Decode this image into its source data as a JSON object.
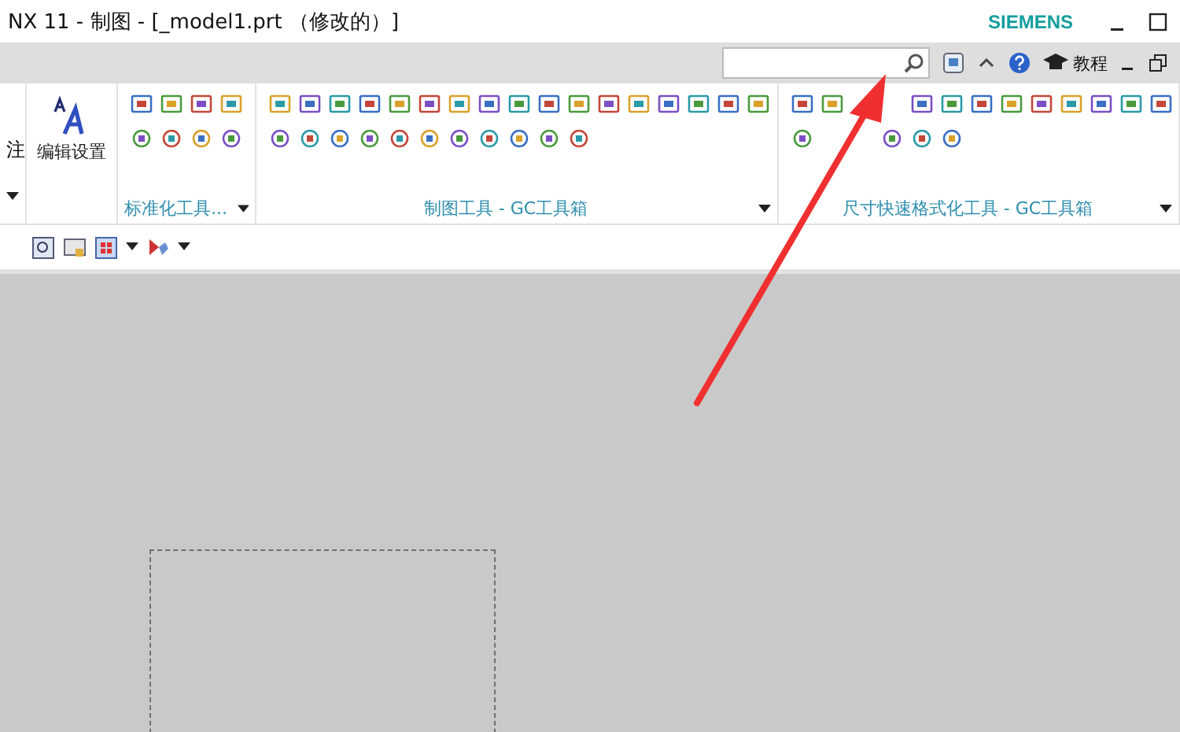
{
  "window": {
    "title": "NX 11 - 制图 - [_model1.prt （修改的）]",
    "brand": "SIEMENS"
  },
  "top_bar": {
    "help_label": "教程"
  },
  "ribbon": {
    "groups": [
      {
        "kind": "partial",
        "label": "注"
      },
      {
        "kind": "big",
        "label": "编辑设置"
      },
      {
        "kind": "icons",
        "title": "标准化工具..."
      },
      {
        "kind": "icons",
        "title": "制图工具 - GC工具箱"
      },
      {
        "kind": "icons",
        "title": "尺寸快速格式化工具 - GC工具箱"
      }
    ]
  }
}
